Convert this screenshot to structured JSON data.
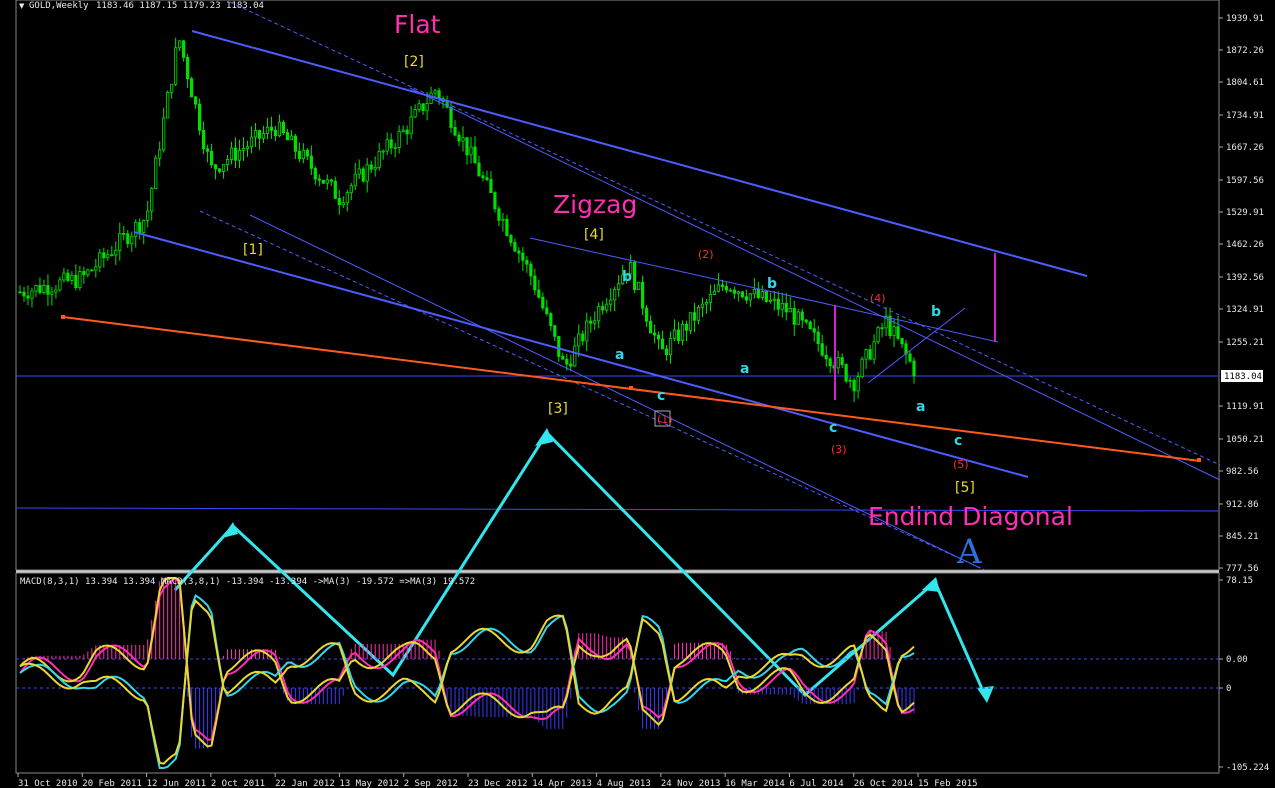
{
  "window": {
    "title": "GOLD,Weekly",
    "ohlc": "1183.46 1187.15 1179.23 1183.04"
  },
  "colors": {
    "background": "#000000",
    "bull_candle": "#00e000",
    "channel": "#4d5cff",
    "support": "#ff5a1e",
    "pattern_label": "#ff2fb0",
    "wave_cyan": "#33d6e8",
    "wave_yellow": "#e8d830",
    "wave_red": "#ff2a2a",
    "macd_histogram_pos": "#ff2fb0",
    "macd_histogram_neg": "#3a3aff",
    "projection": "#33e6ee"
  },
  "chart_data": [
    {
      "type": "line",
      "name": "price-pane",
      "ylim": [
        777.56,
        1939.91
      ],
      "y_ticks": [
        "1939.91",
        "1872.26",
        "1804.61",
        "1734.91",
        "1667.26",
        "1597.56",
        "1529.91",
        "1462.26",
        "1392.56",
        "1324.91",
        "1255.21",
        "1183.04",
        "1119.91",
        "1050.21",
        "982.56",
        "912.86",
        "845.21",
        "777.56"
      ],
      "current_price": "1183.04",
      "x_ticks": [
        "31 Oct 2010",
        "20 Feb 2011",
        "12 Jun 2011",
        "2 Oct 2011",
        "22 Jan 2012",
        "13 May 2012",
        "2 Sep 2012",
        "23 Dec 2012",
        "14 Apr 2013",
        "4 Aug 2013",
        "24 Nov 2013",
        "16 Mar 2014",
        "6 Jul 2014",
        "26 Oct 2014",
        "15 Feb 2015"
      ],
      "approx_weekly_close": [
        {
          "x": "31 Oct 2010",
          "y": 1360
        },
        {
          "x": "20 Feb 2011",
          "y": 1390
        },
        {
          "x": "12 Jun 2011",
          "y": 1520
        },
        {
          "x": "Sep 2011",
          "y": 1900
        },
        {
          "x": "2 Oct 2011",
          "y": 1620
        },
        {
          "x": "22 Jan 2012",
          "y": 1710
        },
        {
          "x": "13 May 2012",
          "y": 1560
        },
        {
          "x": "2 Sep 2012",
          "y": 1700
        },
        {
          "x": "Oct 2012",
          "y": 1790
        },
        {
          "x": "23 Dec 2012",
          "y": 1660
        },
        {
          "x": "14 Apr 2013",
          "y": 1390
        },
        {
          "x": "Jun 2013",
          "y": 1200
        },
        {
          "x": "4 Aug 2013",
          "y": 1320
        },
        {
          "x": "Aug 2013",
          "y": 1420
        },
        {
          "x": "24 Nov 2013",
          "y": 1230
        },
        {
          "x": "16 Mar 2014",
          "y": 1380
        },
        {
          "x": "6 Jul 2014",
          "y": 1320
        },
        {
          "x": "26 Oct 2014",
          "y": 1170
        },
        {
          "x": "Jan 2015",
          "y": 1300
        },
        {
          "x": "15 Feb 2015",
          "y": 1183
        }
      ],
      "pattern_labels": [
        "Flat",
        "Zigzag",
        "Endind Diagonal"
      ],
      "wave_labels": {
        "primary": [
          "[1]",
          "[2]",
          "[3]",
          "[4]",
          "[5]"
        ],
        "intermediate": [
          "(1)",
          "(2)",
          "(3)",
          "(4)",
          "(5)"
        ],
        "minor": [
          "a",
          "b",
          "c",
          "a",
          "b",
          "c",
          "a",
          "b",
          "c"
        ],
        "degree": "A"
      }
    },
    {
      "type": "line",
      "name": "indicator-pane",
      "legend": "MACD(8,3,1) 13.394 13.394  MACD(3,8,1) -13.394 -13.394  ->MA(3) -19.572  =>MA(3) 19.572",
      "y_ticks": [
        "78.15",
        "0.00",
        "0",
        "-105.224"
      ],
      "series": [
        {
          "name": "MACD(8,3,1)",
          "values": [
            13.394,
            13.394
          ]
        },
        {
          "name": "MACD(3,8,1)",
          "values": [
            -13.394,
            -13.394
          ]
        },
        {
          "name": "->MA(3)",
          "values": [
            -19.572
          ]
        },
        {
          "name": "=>MA(3)",
          "values": [
            19.572
          ]
        }
      ]
    }
  ]
}
